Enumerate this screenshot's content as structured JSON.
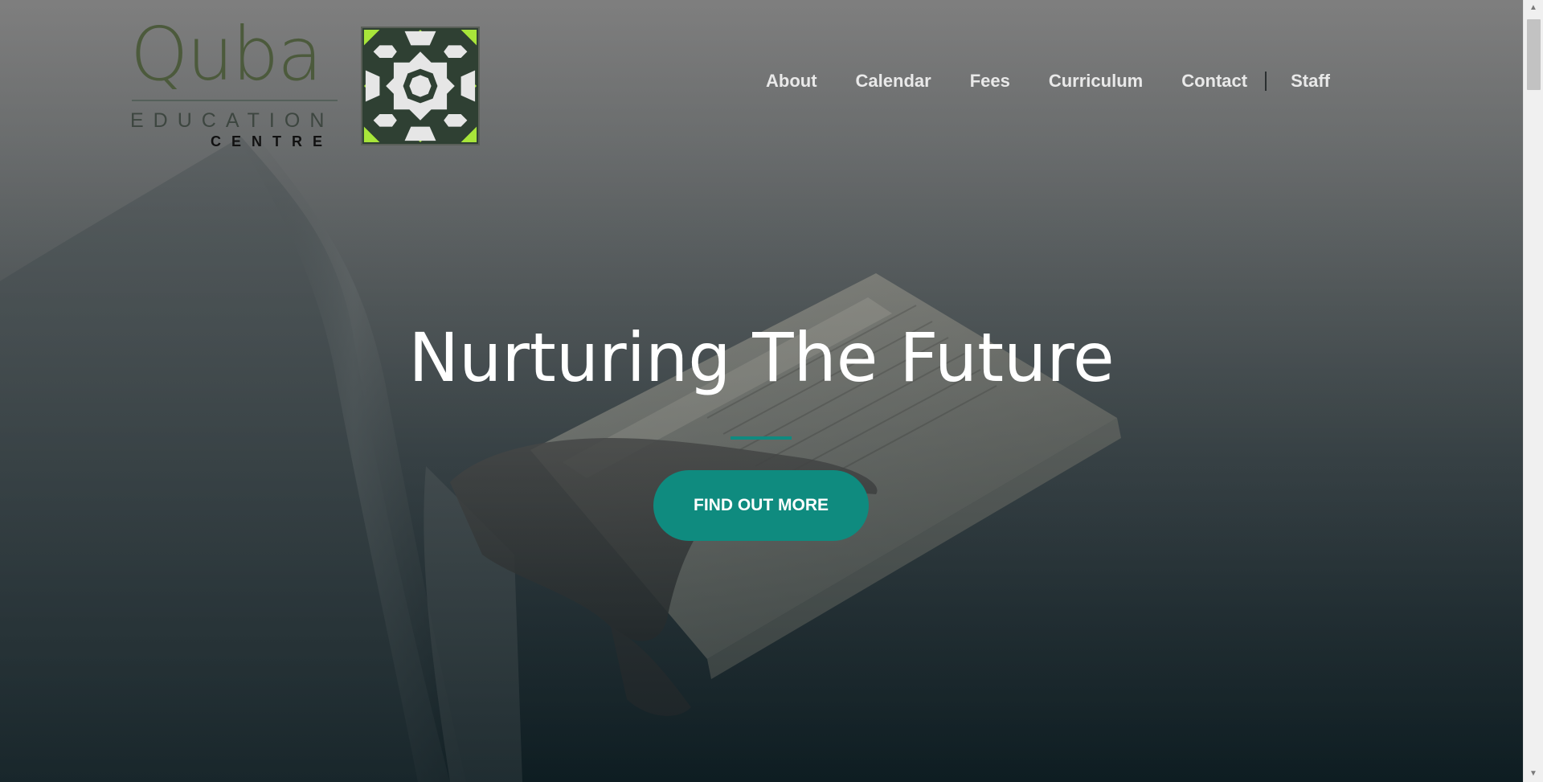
{
  "logo": {
    "wordmark": "Quba",
    "line1": "EDUCATION",
    "line2": "CENTRE"
  },
  "nav": {
    "items": [
      {
        "label": "About"
      },
      {
        "label": "Calendar"
      },
      {
        "label": "Fees"
      },
      {
        "label": "Curriculum"
      },
      {
        "label": "Contact"
      }
    ],
    "staff_label": "Staff"
  },
  "hero": {
    "title": "Nurturing The Future",
    "button_label": "FIND OUT MORE"
  },
  "colors": {
    "accent": "#0f8b7f",
    "logo_green": "#4c5a3c",
    "tile_lime": "#a8e63a"
  },
  "icons": {
    "scroll_up": "triangle-up-icon",
    "scroll_down": "triangle-down-icon"
  }
}
